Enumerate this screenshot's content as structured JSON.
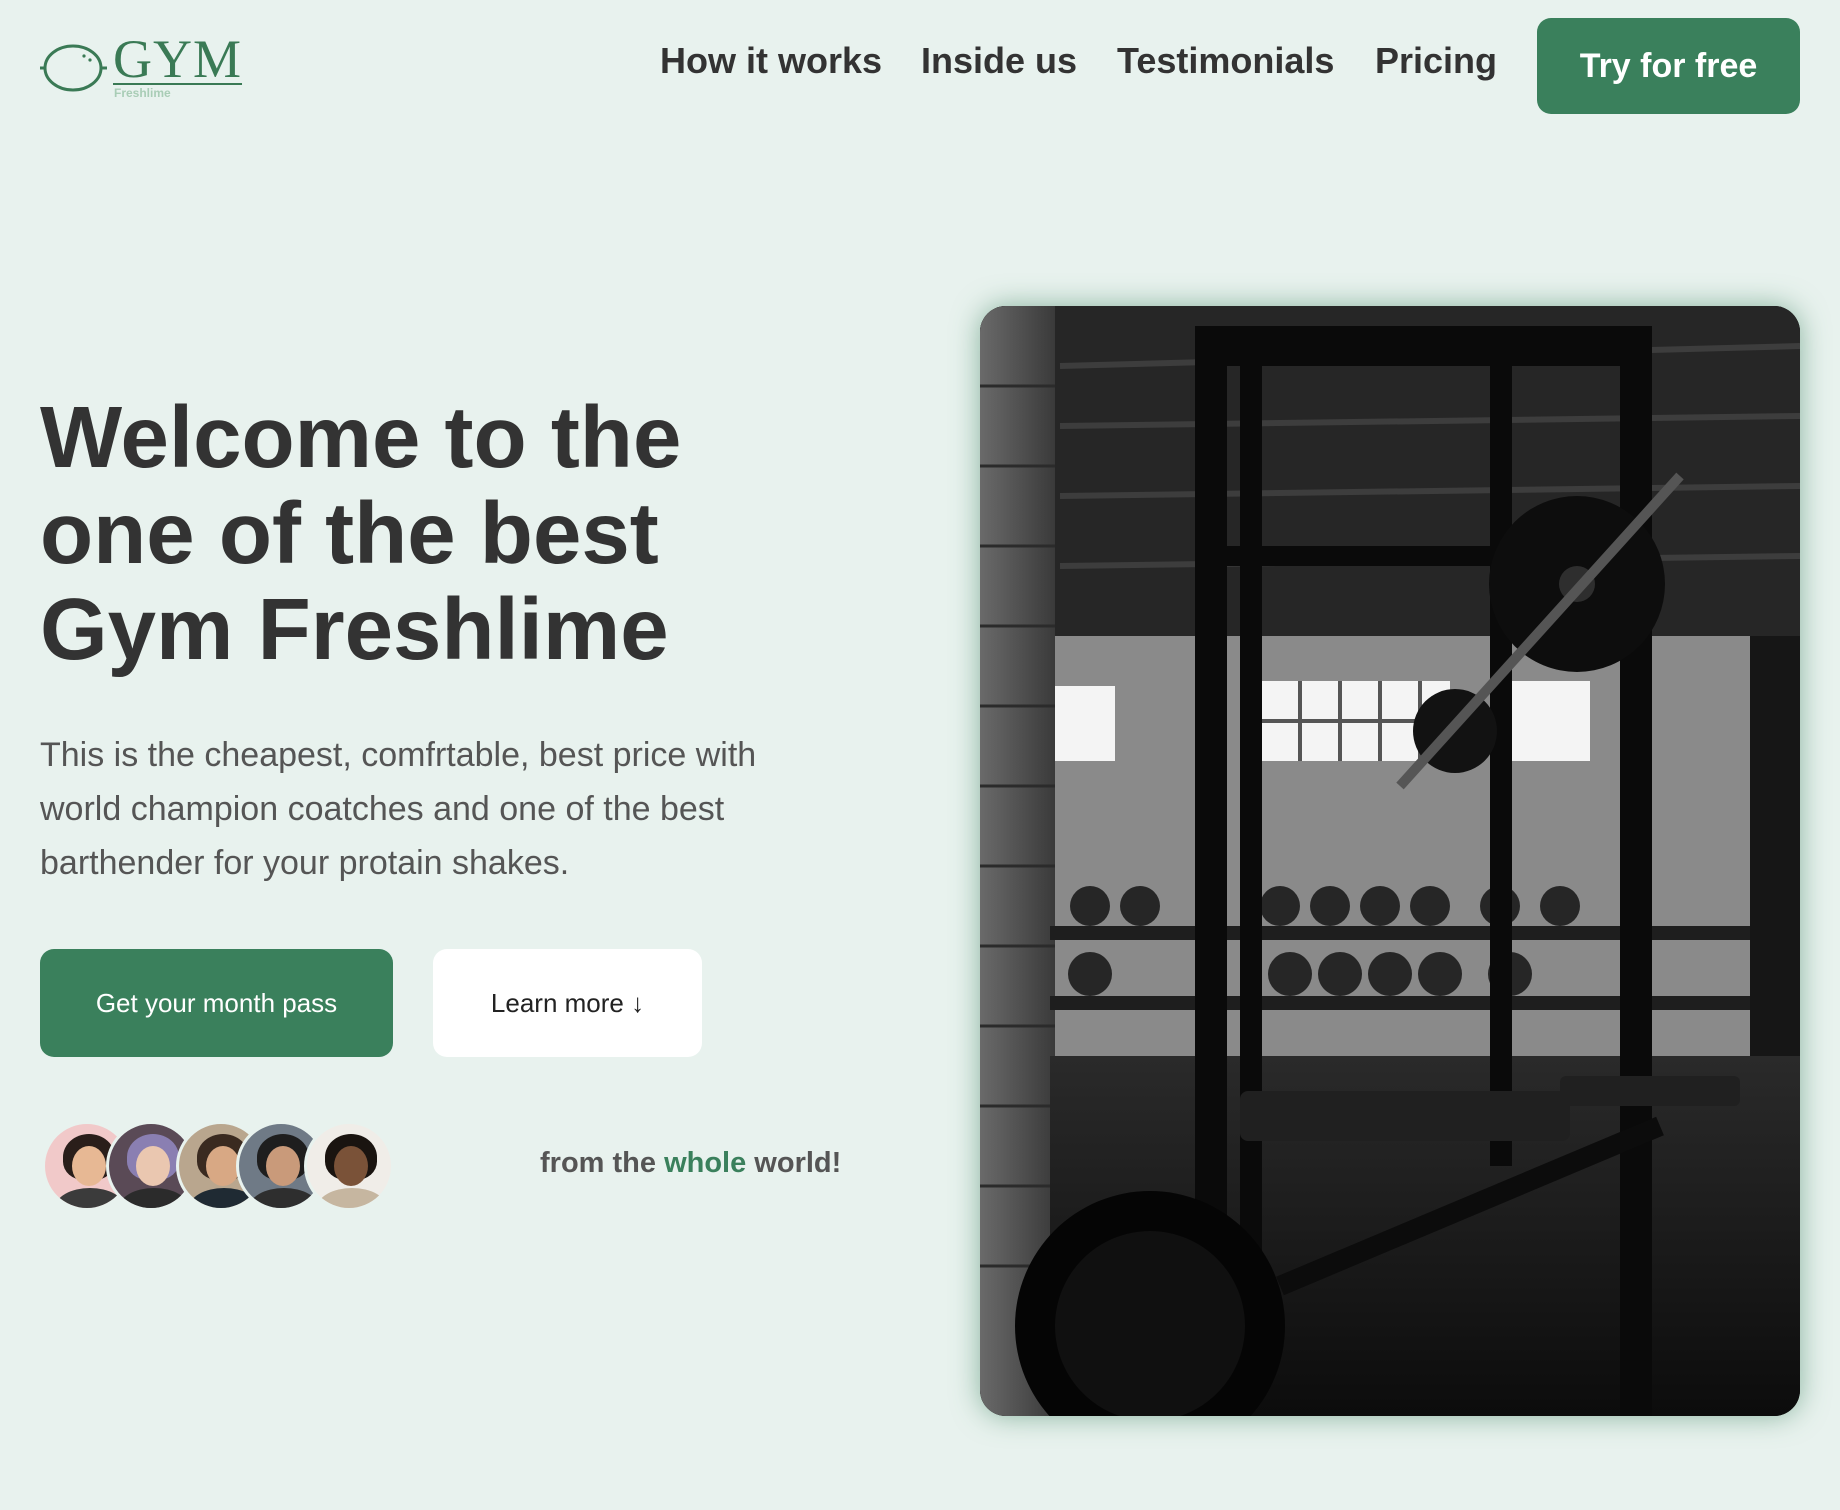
{
  "logo": {
    "word": "GYM",
    "sub": "Freshlime",
    "icon": "lime-icon"
  },
  "nav": {
    "items": [
      "How it works",
      "Inside us",
      "Testimonials",
      "Pricing"
    ],
    "cta_label": "Try for free"
  },
  "hero": {
    "title": "Welcome to the one of the best Gym Freshlime",
    "description": "This is the cheapest, comfrtable, best price with world champion coatches and one of the best barthender for your protain shakes.",
    "primary_button": "Get your month pass",
    "secondary_button": "Learn more ↓",
    "social_proof": {
      "before": "from the ",
      "accent": "whole",
      "after": " world!"
    },
    "image": "gym-power-rack-photo"
  },
  "colors": {
    "background": "#e8f2ee",
    "accent": "#3a805c",
    "text": "#333333"
  }
}
